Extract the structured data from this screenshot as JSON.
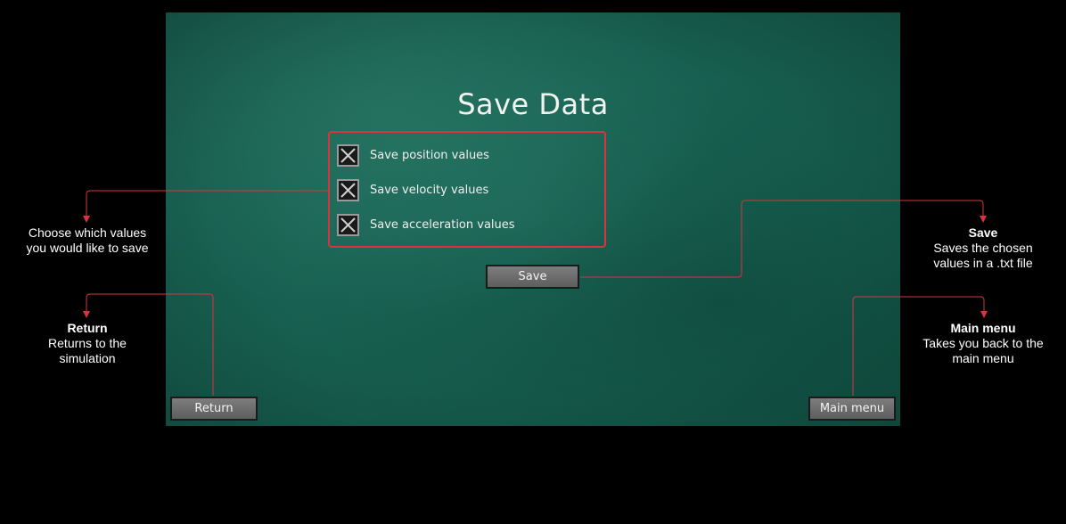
{
  "screen": {
    "title": "Save Data",
    "options": [
      {
        "label": "Save position values",
        "checked": true
      },
      {
        "label": "Save velocity values",
        "checked": true
      },
      {
        "label": "Save acceleration values",
        "checked": true
      }
    ],
    "save_button": "Save",
    "return_button": "Return",
    "main_menu_button": "Main menu"
  },
  "annotations": {
    "choose": {
      "line1": "Choose which values",
      "line2": "you would like to save"
    },
    "save": {
      "title": "Save",
      "line1": "Saves the chosen",
      "line2": "values in a .txt file"
    },
    "return": {
      "title": "Return",
      "line1": "Returns to the",
      "line2": "simulation"
    },
    "main_menu": {
      "title": "Main menu",
      "line1": "Takes you back to the",
      "line2": "main menu"
    }
  },
  "colors": {
    "background": "#000000",
    "chalkboard": "#1a6655",
    "annotation_line": "#d8343f",
    "button": "#6e6e6e"
  }
}
